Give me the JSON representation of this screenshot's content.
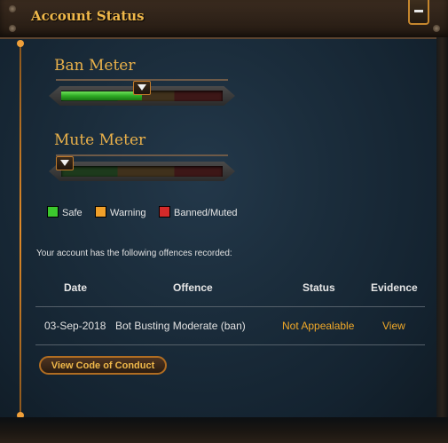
{
  "panel": {
    "title": "Account Status"
  },
  "ban_meter": {
    "label": "Ban Meter",
    "level": 0.5
  },
  "mute_meter": {
    "label": "Mute Meter",
    "level": 0.0
  },
  "legend": [
    {
      "label": "Safe",
      "color": "#3cc82e"
    },
    {
      "label": "Warning",
      "color": "#f0a02a"
    },
    {
      "label": "Banned/Muted",
      "color": "#d42a2a"
    }
  ],
  "offences": {
    "intro": "Your account has the following offences recorded:",
    "headers": {
      "date": "Date",
      "offence": "Offence",
      "status": "Status",
      "evidence": "Evidence"
    },
    "rows": [
      {
        "date": "03-Sep-2018",
        "offence": "Bot Busting Moderate (ban)",
        "status": "Not Appealable",
        "evidence": "View"
      }
    ]
  },
  "code_of_conduct_button": "View Code of Conduct",
  "colors": {
    "accent": "#f0a828",
    "title": "#f0b84a"
  }
}
